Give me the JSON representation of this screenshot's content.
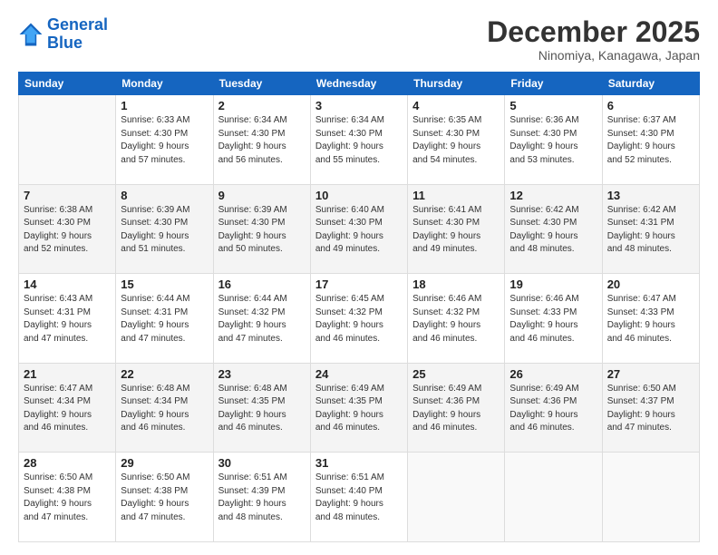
{
  "header": {
    "logo_line1": "General",
    "logo_line2": "Blue",
    "month": "December 2025",
    "location": "Ninomiya, Kanagawa, Japan"
  },
  "weekdays": [
    "Sunday",
    "Monday",
    "Tuesday",
    "Wednesday",
    "Thursday",
    "Friday",
    "Saturday"
  ],
  "weeks": [
    [
      {
        "day": "",
        "info": ""
      },
      {
        "day": "1",
        "info": "Sunrise: 6:33 AM\nSunset: 4:30 PM\nDaylight: 9 hours\nand 57 minutes."
      },
      {
        "day": "2",
        "info": "Sunrise: 6:34 AM\nSunset: 4:30 PM\nDaylight: 9 hours\nand 56 minutes."
      },
      {
        "day": "3",
        "info": "Sunrise: 6:34 AM\nSunset: 4:30 PM\nDaylight: 9 hours\nand 55 minutes."
      },
      {
        "day": "4",
        "info": "Sunrise: 6:35 AM\nSunset: 4:30 PM\nDaylight: 9 hours\nand 54 minutes."
      },
      {
        "day": "5",
        "info": "Sunrise: 6:36 AM\nSunset: 4:30 PM\nDaylight: 9 hours\nand 53 minutes."
      },
      {
        "day": "6",
        "info": "Sunrise: 6:37 AM\nSunset: 4:30 PM\nDaylight: 9 hours\nand 52 minutes."
      }
    ],
    [
      {
        "day": "7",
        "info": "Sunrise: 6:38 AM\nSunset: 4:30 PM\nDaylight: 9 hours\nand 52 minutes."
      },
      {
        "day": "8",
        "info": "Sunrise: 6:39 AM\nSunset: 4:30 PM\nDaylight: 9 hours\nand 51 minutes."
      },
      {
        "day": "9",
        "info": "Sunrise: 6:39 AM\nSunset: 4:30 PM\nDaylight: 9 hours\nand 50 minutes."
      },
      {
        "day": "10",
        "info": "Sunrise: 6:40 AM\nSunset: 4:30 PM\nDaylight: 9 hours\nand 49 minutes."
      },
      {
        "day": "11",
        "info": "Sunrise: 6:41 AM\nSunset: 4:30 PM\nDaylight: 9 hours\nand 49 minutes."
      },
      {
        "day": "12",
        "info": "Sunrise: 6:42 AM\nSunset: 4:30 PM\nDaylight: 9 hours\nand 48 minutes."
      },
      {
        "day": "13",
        "info": "Sunrise: 6:42 AM\nSunset: 4:31 PM\nDaylight: 9 hours\nand 48 minutes."
      }
    ],
    [
      {
        "day": "14",
        "info": "Sunrise: 6:43 AM\nSunset: 4:31 PM\nDaylight: 9 hours\nand 47 minutes."
      },
      {
        "day": "15",
        "info": "Sunrise: 6:44 AM\nSunset: 4:31 PM\nDaylight: 9 hours\nand 47 minutes."
      },
      {
        "day": "16",
        "info": "Sunrise: 6:44 AM\nSunset: 4:32 PM\nDaylight: 9 hours\nand 47 minutes."
      },
      {
        "day": "17",
        "info": "Sunrise: 6:45 AM\nSunset: 4:32 PM\nDaylight: 9 hours\nand 46 minutes."
      },
      {
        "day": "18",
        "info": "Sunrise: 6:46 AM\nSunset: 4:32 PM\nDaylight: 9 hours\nand 46 minutes."
      },
      {
        "day": "19",
        "info": "Sunrise: 6:46 AM\nSunset: 4:33 PM\nDaylight: 9 hours\nand 46 minutes."
      },
      {
        "day": "20",
        "info": "Sunrise: 6:47 AM\nSunset: 4:33 PM\nDaylight: 9 hours\nand 46 minutes."
      }
    ],
    [
      {
        "day": "21",
        "info": "Sunrise: 6:47 AM\nSunset: 4:34 PM\nDaylight: 9 hours\nand 46 minutes."
      },
      {
        "day": "22",
        "info": "Sunrise: 6:48 AM\nSunset: 4:34 PM\nDaylight: 9 hours\nand 46 minutes."
      },
      {
        "day": "23",
        "info": "Sunrise: 6:48 AM\nSunset: 4:35 PM\nDaylight: 9 hours\nand 46 minutes."
      },
      {
        "day": "24",
        "info": "Sunrise: 6:49 AM\nSunset: 4:35 PM\nDaylight: 9 hours\nand 46 minutes."
      },
      {
        "day": "25",
        "info": "Sunrise: 6:49 AM\nSunset: 4:36 PM\nDaylight: 9 hours\nand 46 minutes."
      },
      {
        "day": "26",
        "info": "Sunrise: 6:49 AM\nSunset: 4:36 PM\nDaylight: 9 hours\nand 46 minutes."
      },
      {
        "day": "27",
        "info": "Sunrise: 6:50 AM\nSunset: 4:37 PM\nDaylight: 9 hours\nand 47 minutes."
      }
    ],
    [
      {
        "day": "28",
        "info": "Sunrise: 6:50 AM\nSunset: 4:38 PM\nDaylight: 9 hours\nand 47 minutes."
      },
      {
        "day": "29",
        "info": "Sunrise: 6:50 AM\nSunset: 4:38 PM\nDaylight: 9 hours\nand 47 minutes."
      },
      {
        "day": "30",
        "info": "Sunrise: 6:51 AM\nSunset: 4:39 PM\nDaylight: 9 hours\nand 48 minutes."
      },
      {
        "day": "31",
        "info": "Sunrise: 6:51 AM\nSunset: 4:40 PM\nDaylight: 9 hours\nand 48 minutes."
      },
      {
        "day": "",
        "info": ""
      },
      {
        "day": "",
        "info": ""
      },
      {
        "day": "",
        "info": ""
      }
    ]
  ]
}
